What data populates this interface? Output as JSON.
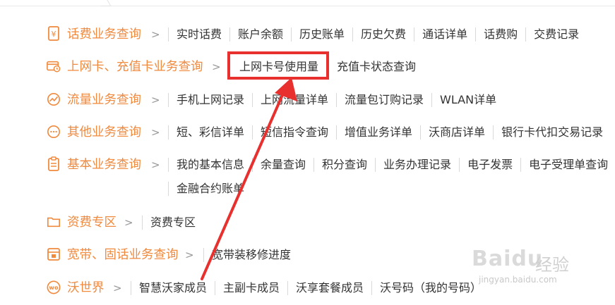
{
  "colors": {
    "category": "#f08a3e",
    "highlight": "#e8312f",
    "text": "#333333",
    "separator": "#d9d9d9"
  },
  "rows": [
    {
      "icon": "yuan-receipt-icon",
      "category": "话费业务查询",
      "links": [
        "实时话费",
        "账户余额",
        "历史账单",
        "历史欠费",
        "通话详单",
        "话费购",
        "交费记录"
      ]
    },
    {
      "icon": "card-clock-icon",
      "category": "上网卡、充值卡业务查询",
      "links": [
        "上网卡号使用量",
        "充值卡状态查询"
      ]
    },
    {
      "icon": "traffic-chart-icon",
      "category": "流量业务查询",
      "links": [
        "手机上网记录",
        "上网流量详单",
        "流量包订购记录",
        "WLAN详单"
      ]
    },
    {
      "icon": "chat-bubble-icon",
      "category": "其他业务查询",
      "links": [
        "短、彩信详单",
        "短信指令查询",
        "增值业务详单",
        "沃商店详单",
        "银行卡代扣交易记录"
      ]
    },
    {
      "icon": "clipboard-icon",
      "category": "基本业务查询",
      "links": [
        "我的基本信息",
        "余量查询",
        "积分查询",
        "业务办理记录",
        "电子发票",
        "电子受理单查询"
      ],
      "links_line2": [
        "金融合约账单"
      ]
    },
    {
      "icon": "folder-icon",
      "category": "资费专区",
      "links": [
        "资费专区"
      ]
    },
    {
      "icon": "calendar-icon",
      "category": "宽带、固话业务查询",
      "links": [
        "宽带装移修进度"
      ]
    },
    {
      "icon": "wo-circle-icon",
      "category": "沃世界",
      "links": [
        "智慧沃家成员",
        "主副卡成员",
        "沃享套餐成员",
        "沃号码（我的号码）"
      ]
    }
  ],
  "chevron": ">",
  "watermark": {
    "brand": "Baidu",
    "cn": "经验",
    "url": "jingyan.baidu.com"
  }
}
